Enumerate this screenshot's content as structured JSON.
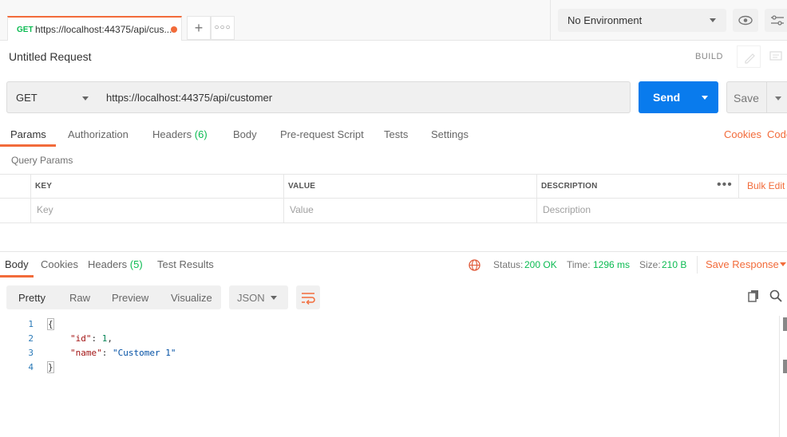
{
  "tab": {
    "method": "GET",
    "url": "https://localhost:44375/api/cus..."
  },
  "environment": {
    "selected": "No Environment"
  },
  "request": {
    "title": "Untitled Request",
    "build_label": "BUILD",
    "method": "GET",
    "url": "https://localhost:44375/api/customer",
    "send_label": "Send",
    "save_label": "Save"
  },
  "request_tabs": {
    "params": "Params",
    "authorization": "Authorization",
    "headers": "Headers",
    "headers_count": "(6)",
    "body": "Body",
    "prerequest": "Pre-request Script",
    "tests": "Tests",
    "settings": "Settings",
    "cookies": "Cookies",
    "code": "Code"
  },
  "query_params": {
    "title": "Query Params",
    "col_key": "KEY",
    "col_value": "VALUE",
    "col_description": "DESCRIPTION",
    "bulk_edit": "Bulk Edit",
    "key_placeholder": "Key",
    "value_placeholder": "Value",
    "description_placeholder": "Description"
  },
  "response_tabs": {
    "body": "Body",
    "cookies": "Cookies",
    "headers": "Headers",
    "headers_count": "(5)",
    "test_results": "Test Results"
  },
  "response_status": {
    "status_label": "Status:",
    "status_value": "200 OK",
    "time_label": "Time:",
    "time_value": "1296 ms",
    "size_label": "Size:",
    "size_value": "210 B",
    "save_response": "Save Response"
  },
  "view": {
    "pretty": "Pretty",
    "raw": "Raw",
    "preview": "Preview",
    "visualize": "Visualize",
    "format": "JSON"
  },
  "code_lines": {
    "l1": "1",
    "l2": "2",
    "l3": "3",
    "l4": "4",
    "open_brace": "{",
    "id_key": "\"id\"",
    "id_value": "1",
    "name_key": "\"name\"",
    "name_value": "\"Customer 1\"",
    "close_brace": "}"
  },
  "colors": {
    "accent": "#f26b3a",
    "send": "#097bed",
    "success": "#0cbb52"
  },
  "icons": [
    "plus-icon",
    "more-icon",
    "eye-icon",
    "sliders-icon",
    "pencil-icon",
    "comment-icon",
    "globe-icon",
    "wrap-icon",
    "copy-icon",
    "search-icon"
  ]
}
